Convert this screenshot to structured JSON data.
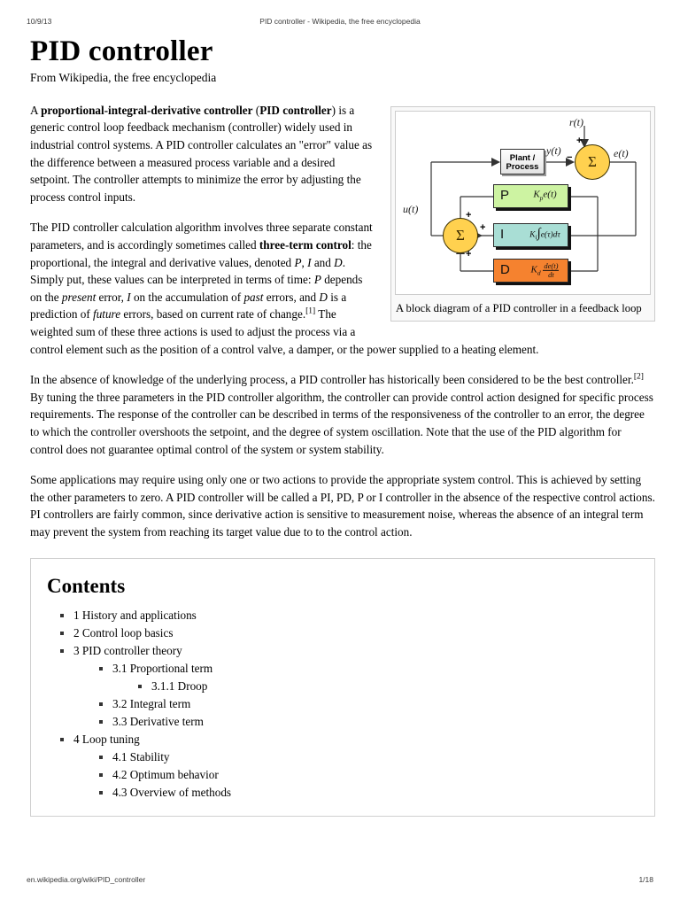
{
  "print_header": {
    "date": "10/9/13",
    "document_title": "PID controller - Wikipedia, the free encyclopedia"
  },
  "print_footer": {
    "url": "en.wikipedia.org/wiki/PID_controller",
    "page": "1/18"
  },
  "article": {
    "title": "PID controller",
    "tagline": "From Wikipedia, the free encyclopedia",
    "paragraphs": {
      "p1_a": "A ",
      "p1_bold1": "proportional-integral-derivative controller",
      "p1_b": " (",
      "p1_bold2": "PID controller",
      "p1_c": ") is a generic control loop feedback mechanism (controller) widely used in industrial control systems. A PID controller calculates an \"error\" value as the difference between a measured process variable and a desired setpoint. The controller attempts to minimize the error by adjusting the process control inputs.",
      "p2_a": "The PID controller calculation algorithm involves three separate constant parameters, and is accordingly sometimes called ",
      "p2_bold": "three-term control",
      "p2_b": ": the proportional, the integral and derivative values, denoted ",
      "p2_i1": "P",
      "p2_c": ", ",
      "p2_i2": "I",
      "p2_d": " and ",
      "p2_i3": "D",
      "p2_e": ". Simply put, these values can be interpreted in terms of time: ",
      "p2_i4": "P",
      "p2_f": " depends on the ",
      "p2_i5": "present",
      "p2_g": " error, ",
      "p2_i6": "I",
      "p2_h": " on the accumulation of ",
      "p2_i7": "past",
      "p2_j": " errors, and ",
      "p2_i8": "D",
      "p2_k": " is a prediction of ",
      "p2_i9": "future",
      "p2_l": " errors, based on current rate of change.",
      "p2_ref": "[1]",
      "p2_m": " The weighted sum of these three actions is used to adjust the process via a control element such as the position of a control valve, a damper, or the power supplied to a heating element.",
      "p3_a": "In the absence of knowledge of the underlying process, a PID controller has historically been considered to be the best controller.",
      "p3_ref": "[2]",
      "p3_b": " By tuning the three parameters in the PID controller algorithm, the controller can provide control action designed for specific process requirements. The response of the controller can be described in terms of the responsiveness of the controller to an error, the degree to which the controller overshoots the setpoint, and the degree of system oscillation. Note that the use of the PID algorithm for control does not guarantee optimal control of the system or system stability.",
      "p4": "Some applications may require using only one or two actions to provide the appropriate system control. This is achieved by setting the other parameters to zero. A PID controller will be called a PI, PD, P or I controller in the absence of the respective control actions. PI controllers are fairly common, since derivative action is sensitive to measurement noise, whereas the absence of an integral term may prevent the system from reaching its target value due to to the control action."
    }
  },
  "figure": {
    "caption": "A block diagram of a PID controller in a feedback loop",
    "labels": {
      "reference": "r(t)",
      "output": "y(t)",
      "error": "e(t)",
      "control": "u(t)"
    },
    "signs": {
      "sum_right_plus": "+",
      "sum_right_minus": "−",
      "sum_left_plus_p": "+",
      "sum_left_plus_i": "+",
      "sum_left_plus_d": "+"
    },
    "sum_symbol": "Σ",
    "plant": {
      "line1": "Plant /",
      "line2": "Process"
    },
    "blocks": [
      {
        "letter": "P",
        "formula_k": "K",
        "formula_sub": "p",
        "formula_rest": "e(t)",
        "color": "#cdf3a2",
        "name": "proportional"
      },
      {
        "letter": "I",
        "formula_k": "K",
        "formula_sub": "i",
        "formula_rest": "e(τ)dτ",
        "color": "#a9ded5",
        "name": "integral"
      },
      {
        "letter": "D",
        "formula_k": "K",
        "formula_sub": "d",
        "formula_num": "de(t)",
        "formula_den": "dt",
        "color": "#f5822f",
        "name": "derivative"
      }
    ],
    "sum_circle_color": "#ffd14f"
  },
  "toc": {
    "heading": "Contents",
    "items": [
      {
        "level": 1,
        "label": "1 History and applications"
      },
      {
        "level": 1,
        "label": "2 Control loop basics"
      },
      {
        "level": 1,
        "label": "3 PID controller theory"
      },
      {
        "level": 2,
        "label": "3.1 Proportional term"
      },
      {
        "level": 3,
        "label": "3.1.1 Droop"
      },
      {
        "level": 2,
        "label": "3.2 Integral term"
      },
      {
        "level": 2,
        "label": "3.3 Derivative term"
      },
      {
        "level": 1,
        "label": "4 Loop tuning"
      },
      {
        "level": 2,
        "label": "4.1 Stability"
      },
      {
        "level": 2,
        "label": "4.2 Optimum behavior"
      },
      {
        "level": 2,
        "label": "4.3 Overview of methods"
      }
    ]
  }
}
